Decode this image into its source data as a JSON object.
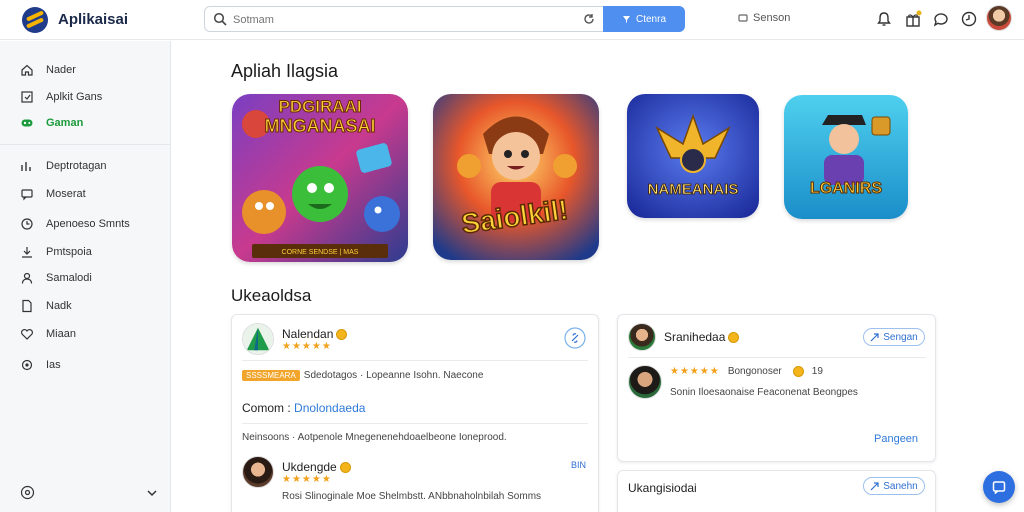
{
  "app": {
    "title": "Aplikaisai"
  },
  "search": {
    "placeholder": "Sotmam",
    "button_label": "Ctenra"
  },
  "header": {
    "sensor_label": "Senson"
  },
  "sidebar": {
    "items": [
      {
        "label": "Nader",
        "icon": "home-icon"
      },
      {
        "label": "Aplkit Gans",
        "icon": "apps-icon"
      },
      {
        "label": "Gaman",
        "icon": "gamepad-icon",
        "active": true
      },
      {
        "label": "Deptrotagan",
        "icon": "chart-icon"
      },
      {
        "label": "Moserat",
        "icon": "message-icon"
      },
      {
        "label": "Apenoeso Smnts",
        "icon": "clock-icon"
      },
      {
        "label": "Pmtspoia",
        "icon": "download-icon"
      },
      {
        "label": "Samalodi",
        "icon": "user-icon"
      },
      {
        "label": "Nadk",
        "icon": "document-icon"
      },
      {
        "label": "Miaan",
        "icon": "heart-icon"
      },
      {
        "label": "Ias",
        "icon": "settings-icon"
      }
    ]
  },
  "featured": {
    "title": "Apliah Ilagsia",
    "tiles": [
      {
        "caption_top": "PDGIRAAI",
        "caption_main": "MNGANASAI",
        "caption_bottom": "CORNE SENDSE | MAS"
      },
      {
        "caption_main": "Saiolkil!"
      },
      {
        "caption_main": "NAMEANAIS"
      },
      {
        "caption_main": "LGANIRS"
      }
    ]
  },
  "reviews": {
    "title": "Ukeaoldsa",
    "card1": {
      "author": "Nalendan",
      "stars": "★★★★★",
      "tag": "SSSSMEARA",
      "meta": "Sdedotagos · Lopeanne Isohn. Naecone",
      "comment_label": "Comom :",
      "comment_link": "Dnolondaeda",
      "body": "Neinsoons · Aotpenole Mnegenenehdoaelbeone Ioneprood.",
      "reply_author": "Ukdengde",
      "reply_stars": "★★★★★",
      "reply_action": "BIN",
      "reply_body": "Rosi Slinoginale Moe Shelmbstt. ANbbnaholnbilah Somms"
    },
    "card2": {
      "author": "Sranihedaa",
      "follow_label": "Sengan",
      "reply_stars": "★★★★★",
      "reply_name": "Bongonoser",
      "reply_count": "19",
      "reply_body": "Sonin Iloesaonaise Feaconenat Beongpes",
      "footer_link": "Pangeen"
    },
    "card3": {
      "author": "Ukangisiodai",
      "follow_label": "Sanehn"
    }
  }
}
